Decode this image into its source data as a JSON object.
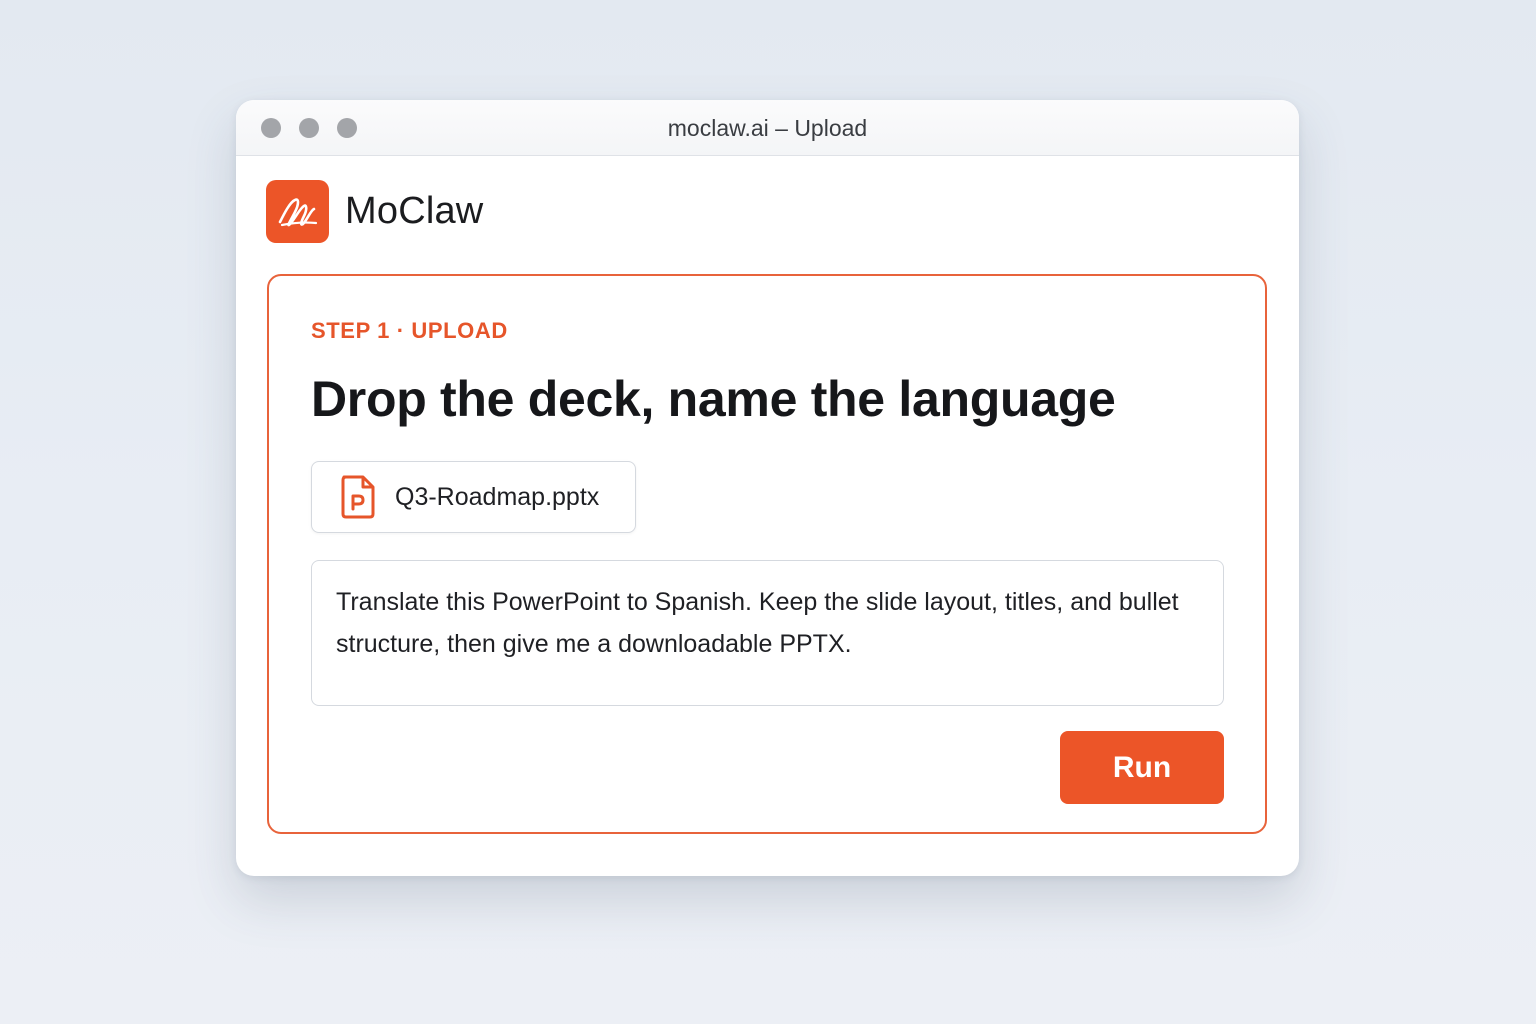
{
  "window": {
    "title": "moclaw.ai – Upload"
  },
  "brand": {
    "name": "MoClaw",
    "logo_icon": "moclaw-logo-icon",
    "accent_color": "#ec5528"
  },
  "step": {
    "label": "STEP 1 · UPLOAD",
    "headline": "Drop the deck, name the language"
  },
  "attachment": {
    "file_name": "Q3-Roadmap.pptx",
    "icon": "powerpoint-file-icon"
  },
  "prompt": {
    "text": "Translate this PowerPoint to Spanish. Keep the slide layout, titles, and bullet structure, then give me a downloadable PPTX."
  },
  "actions": {
    "run_label": "Run"
  }
}
